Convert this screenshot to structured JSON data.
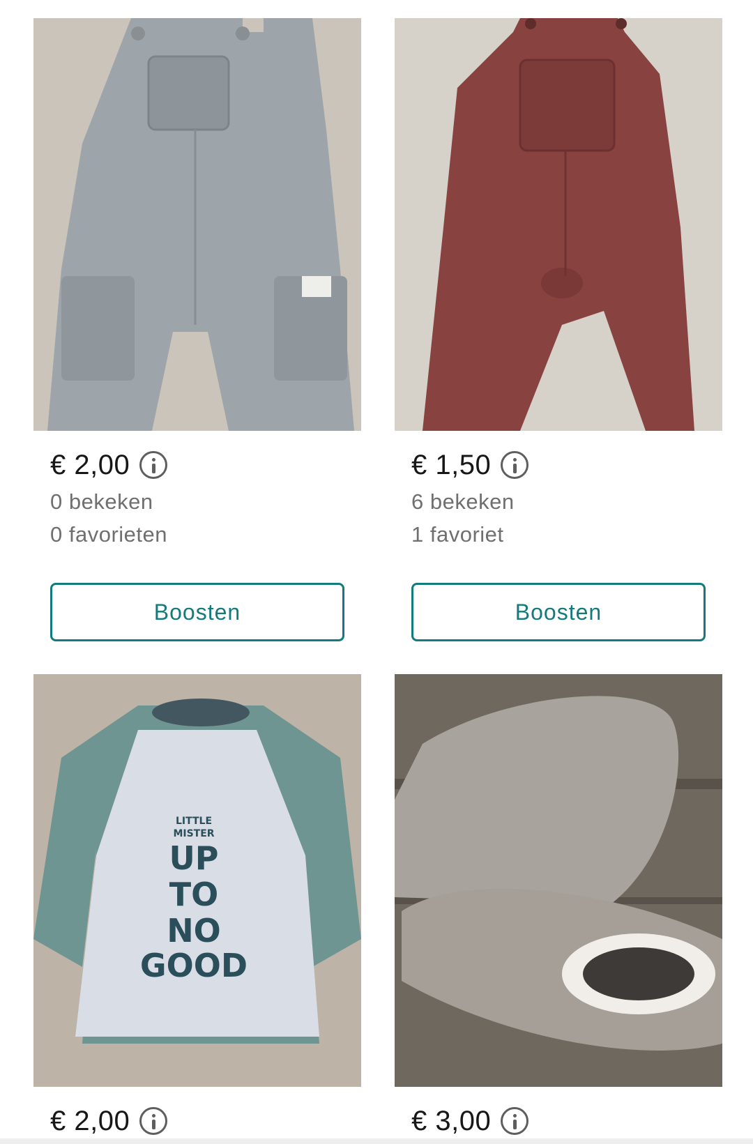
{
  "items": [
    {
      "price": "€ 2,00",
      "views": "0 bekeken",
      "favorites": "0 favorieten",
      "boost_label": "Boosten",
      "image": "grey-baby-dungarees"
    },
    {
      "price": "€ 1,50",
      "views": "6 bekeken",
      "favorites": "1 favoriet",
      "boost_label": "Boosten",
      "image": "red-baby-dungarees"
    },
    {
      "price": "€ 2,00",
      "image": "baby-raglan-shirt",
      "shirt_print": [
        "LITTLE",
        "MISTER",
        "UP",
        "TO",
        "NO",
        "GOOD"
      ]
    },
    {
      "price": "€ 3,00",
      "image": "grey-baby-slippers"
    }
  ],
  "colors": {
    "accent": "#137b7d",
    "price_text": "#171717",
    "meta_text": "#6f6f6f"
  },
  "icons": {
    "price_info": "info-circle-icon"
  }
}
